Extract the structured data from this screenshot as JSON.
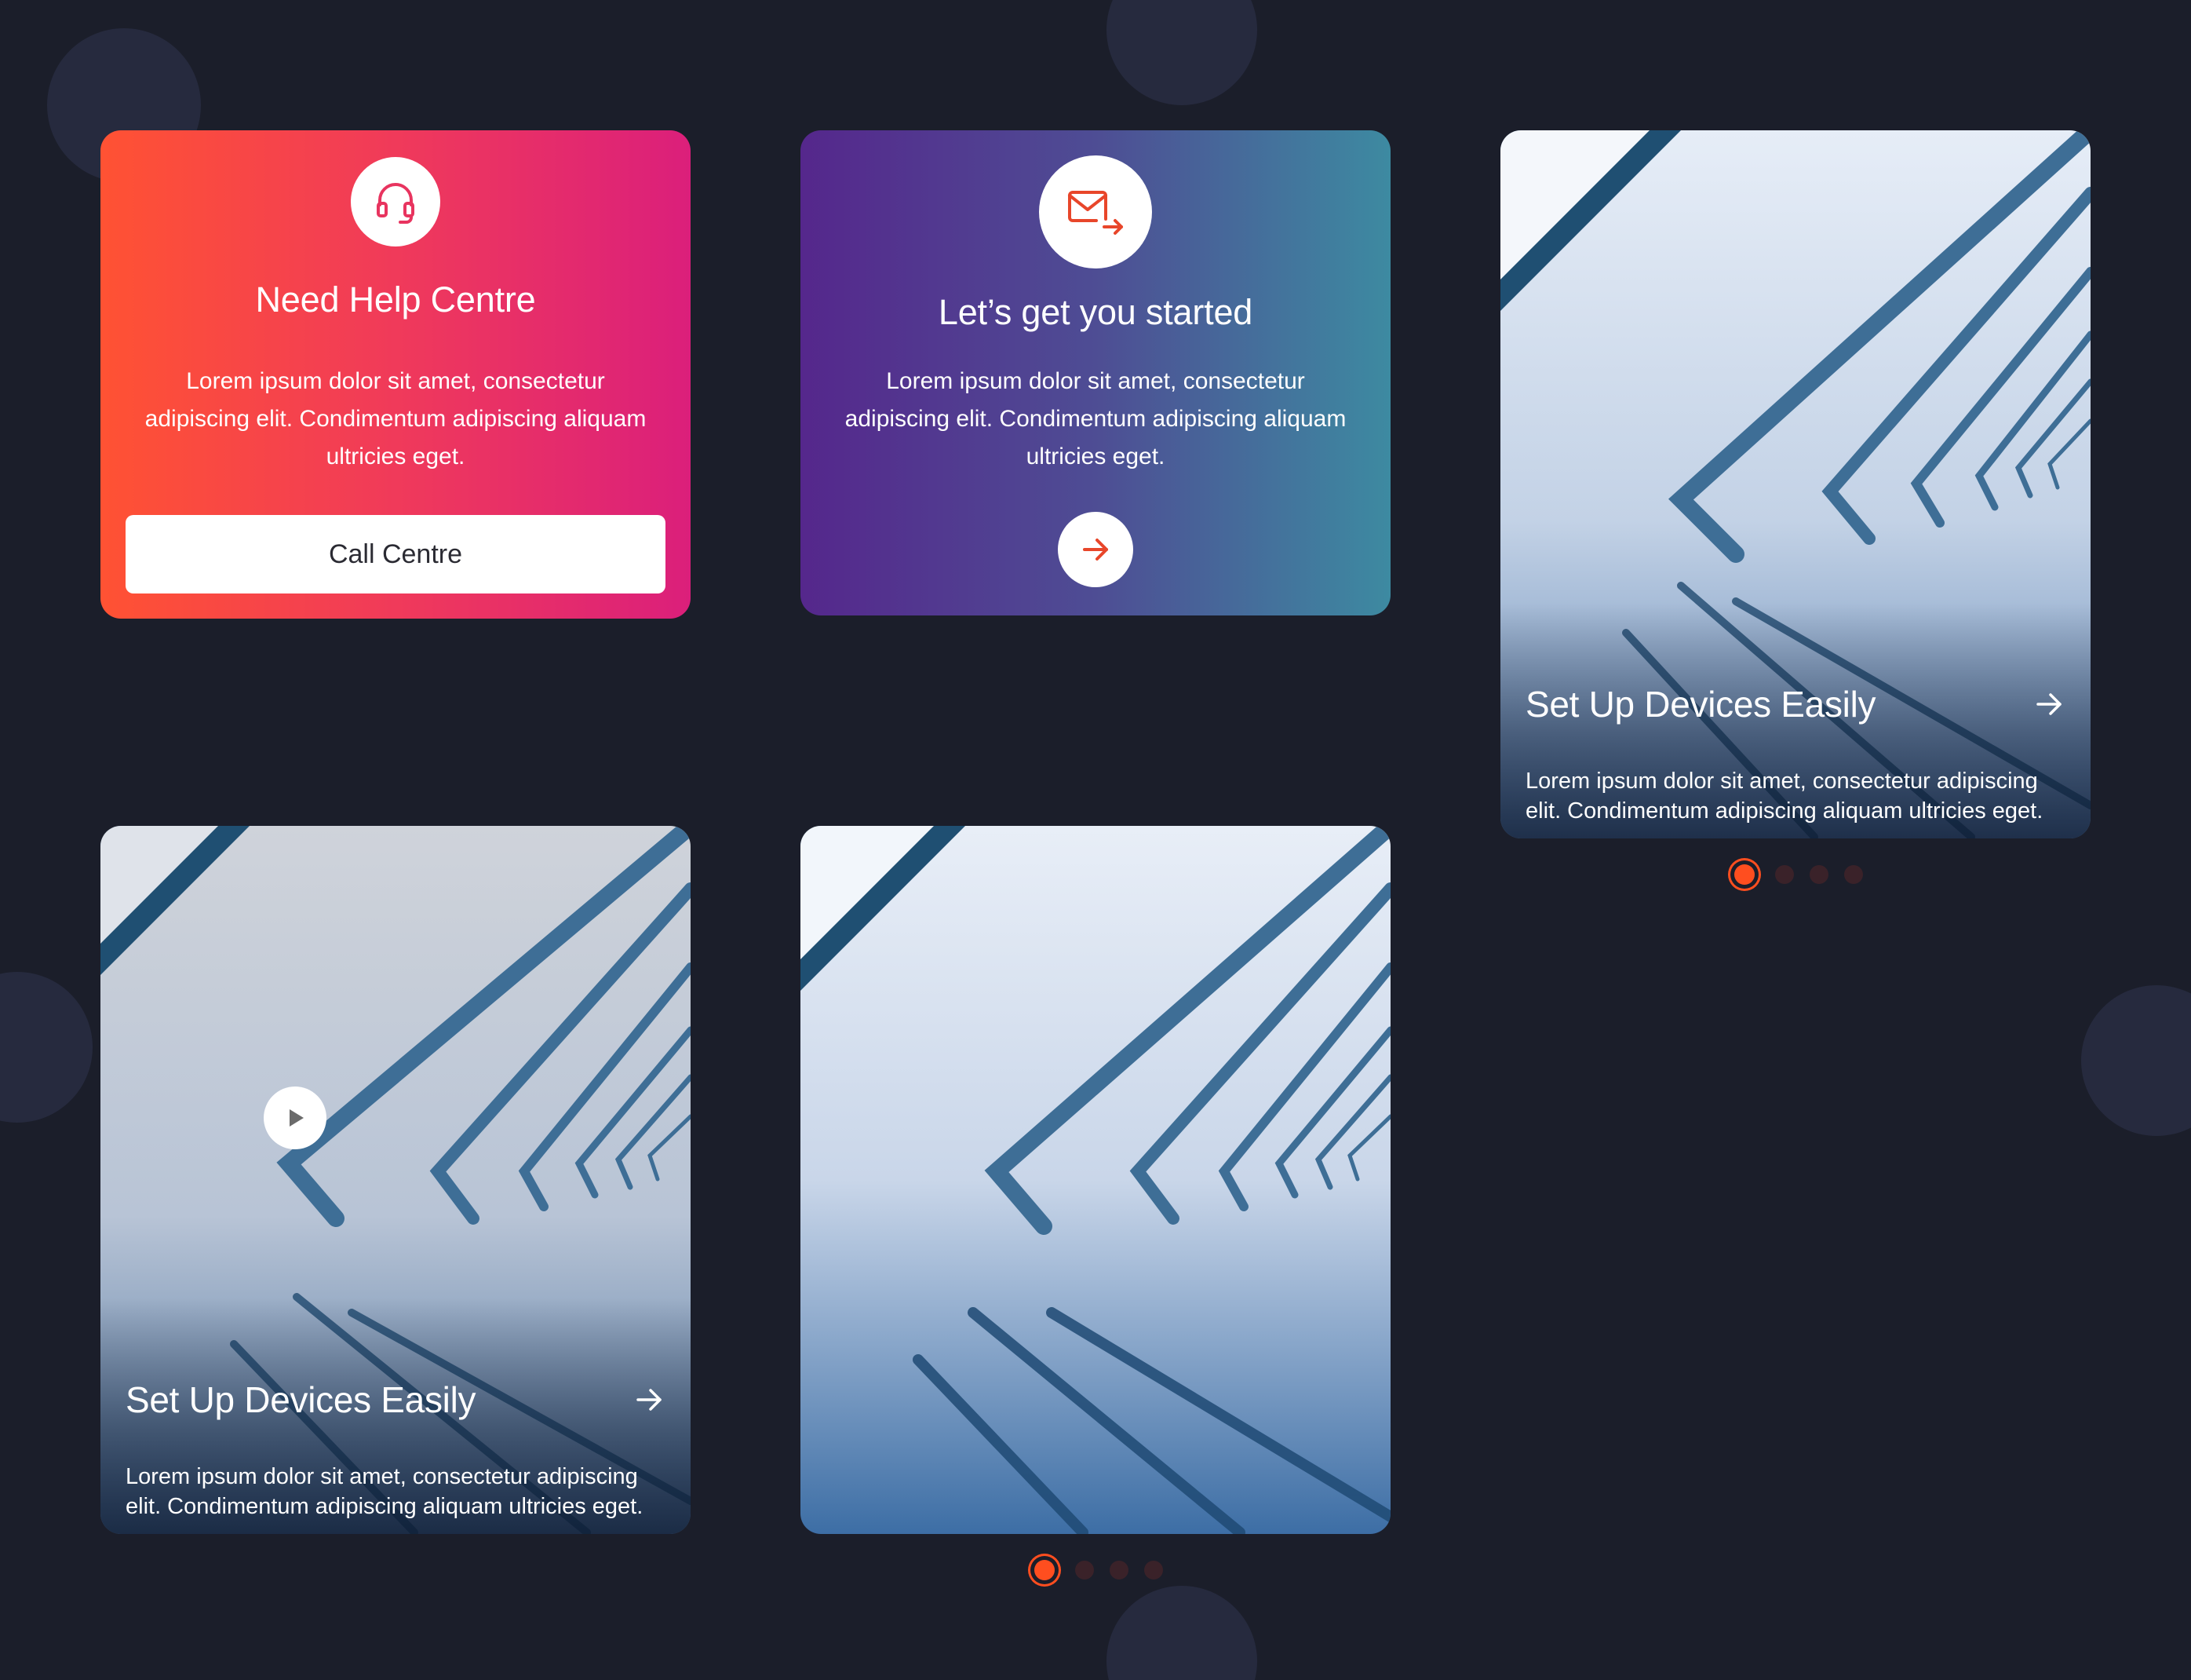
{
  "colors": {
    "background": "#1b1e2a",
    "accent": "#ff4e1f",
    "help_gradient": [
      "#ff5233",
      "#db1f7b"
    ],
    "start_gradient": [
      "#55278c",
      "#3d8aa1"
    ]
  },
  "help_card": {
    "icon": "headset-icon",
    "title": "Need Help Centre",
    "text": "Lorem ipsum dolor sit amet, consectetur adipiscing elit. Condimentum adipiscing aliquam ultricies eget.",
    "button_label": "Call Centre"
  },
  "start_card": {
    "icon": "mail-forward-icon",
    "title": "Let’s get you started",
    "text": "Lorem ipsum dolor sit amet, consectetur adipiscing elit. Condimentum adipiscing aliquam ultricies eget.",
    "action_icon": "arrow-right-icon"
  },
  "image_card_top_right": {
    "title": "Set Up Devices Easily",
    "text": "Lorem ipsum dolor sit amet, consectetur adipiscing elit. Condimentum adipiscing aliquam ultricies eget.",
    "pagination": {
      "total": 4,
      "active": 1
    }
  },
  "image_card_bottom_left": {
    "title": "Set Up Devices Easily",
    "text": "Lorem ipsum dolor sit amet, consectetur adipiscing elit. Condimentum adipiscing aliquam ultricies eget.",
    "play_icon": "play-icon"
  },
  "image_card_bottom_middle": {
    "pagination": {
      "total": 4,
      "active": 1
    }
  }
}
